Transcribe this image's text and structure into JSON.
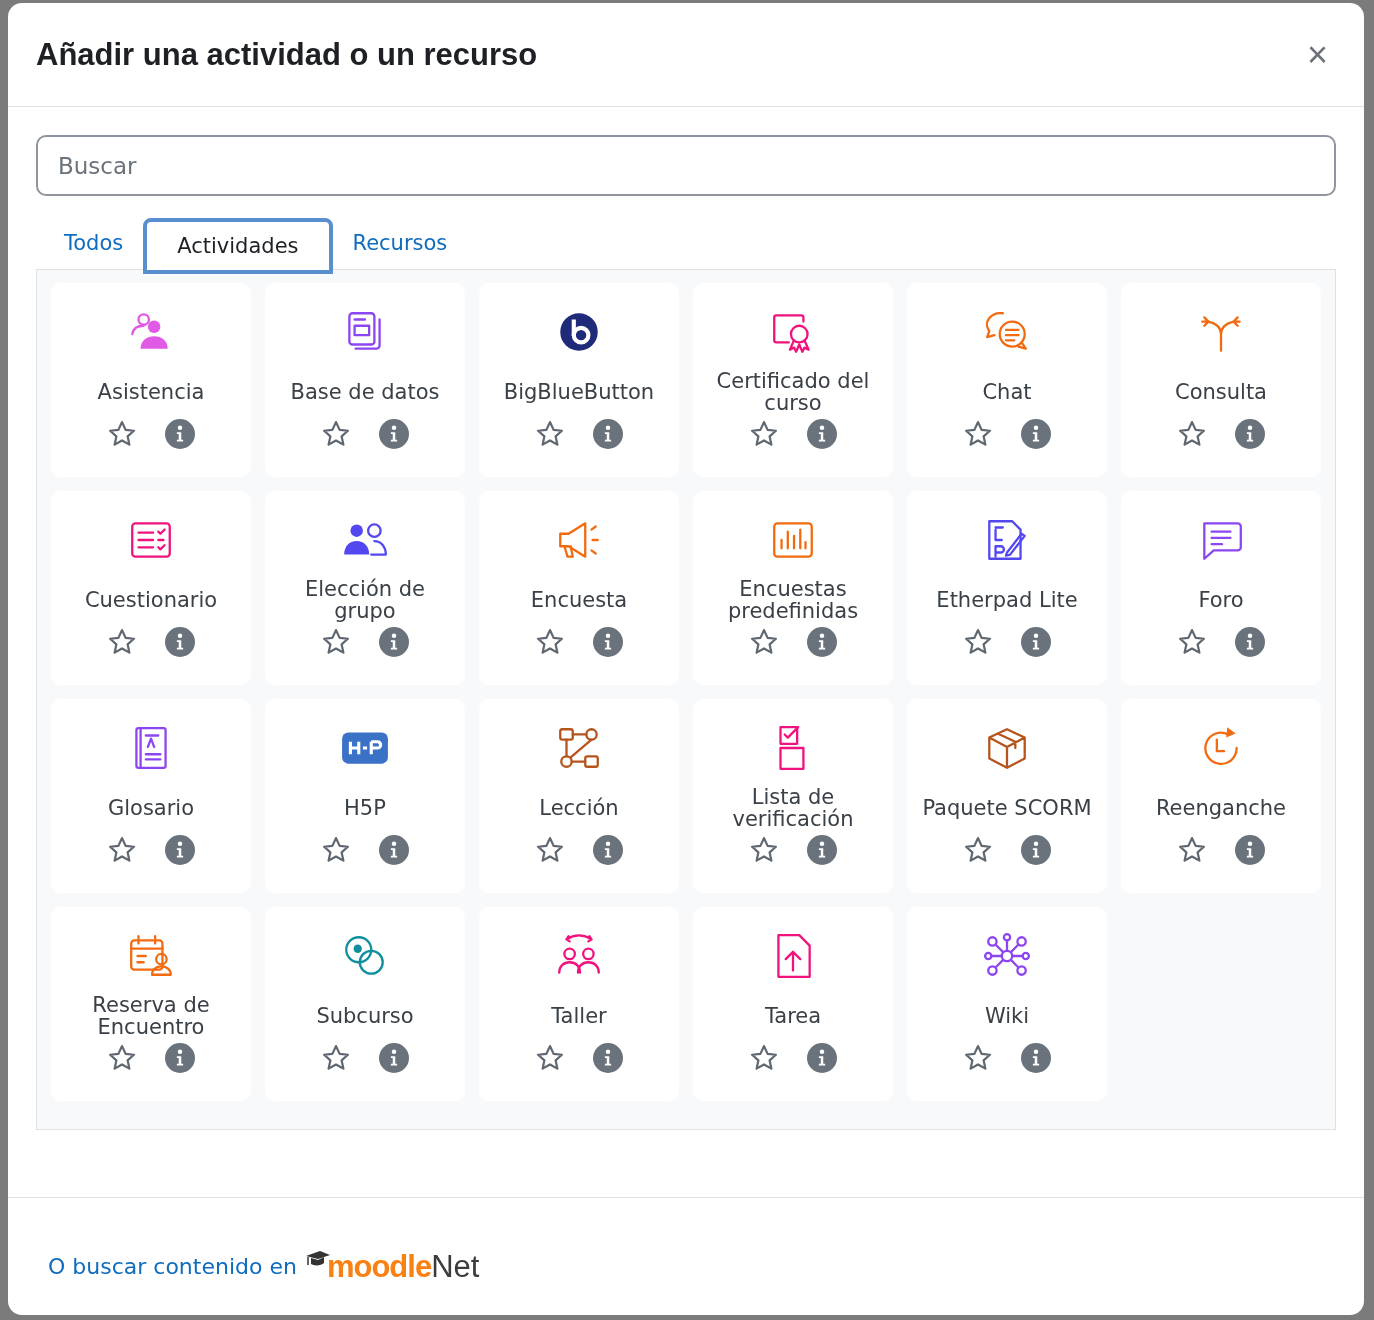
{
  "dialog": {
    "title": "Añadir una actividad o un recurso",
    "close": "×"
  },
  "search": {
    "placeholder": "Buscar"
  },
  "tabs": [
    {
      "label": "Todos",
      "selected": false
    },
    {
      "label": "Actividades",
      "selected": true
    },
    {
      "label": "Recursos",
      "selected": false
    }
  ],
  "items": [
    {
      "label": "Asistencia",
      "color": "#e05ae6",
      "starred": false
    },
    {
      "label": "Base de datos",
      "color": "#8c45f2",
      "starred": false
    },
    {
      "label": "BigBlueButton",
      "color": "#1f2a78",
      "starred": false
    },
    {
      "label": "Certificado del curso",
      "color": "#f0137e",
      "starred": false
    },
    {
      "label": "Chat",
      "color": "#f26b10",
      "starred": false
    },
    {
      "label": "Consulta",
      "color": "#f26b10",
      "starred": false
    },
    {
      "label": "Cuestionario",
      "color": "#f0137e",
      "starred": false
    },
    {
      "label": "Elección de grupo",
      "color": "#5348f0",
      "starred": false
    },
    {
      "label": "Encuesta",
      "color": "#f26b10",
      "starred": false
    },
    {
      "label": "Encuestas predefinidas",
      "color": "#f26b10",
      "starred": false
    },
    {
      "label": "Etherpad Lite",
      "color": "#5348f0",
      "starred": false
    },
    {
      "label": "Foro",
      "color": "#8c45f2",
      "starred": false
    },
    {
      "label": "Glosario",
      "color": "#8c45f2",
      "starred": false
    },
    {
      "label": "H5P",
      "color": "#3a72c8",
      "starred": false
    },
    {
      "label": "Lección",
      "color": "#b5541c",
      "starred": false
    },
    {
      "label": "Lista de verificación",
      "color": "#f0137e",
      "starred": false
    },
    {
      "label": "Paquete SCORM",
      "color": "#b5541c",
      "starred": false
    },
    {
      "label": "Reenganche",
      "color": "#f26b10",
      "starred": false
    },
    {
      "label": "Reserva de Encuentro",
      "color": "#f26b10",
      "starred": false
    },
    {
      "label": "Subcurso",
      "color": "#0f8f9e",
      "starred": false
    },
    {
      "label": "Taller",
      "color": "#f0137e",
      "starred": false
    },
    {
      "label": "Tarea",
      "color": "#f0137e",
      "starred": false
    },
    {
      "label": "Wiki",
      "color": "#8c45f2",
      "starred": false
    }
  ],
  "footer": {
    "text": "O buscar contenido en",
    "logo_word": "moodle",
    "logo_suffix": "Net"
  }
}
